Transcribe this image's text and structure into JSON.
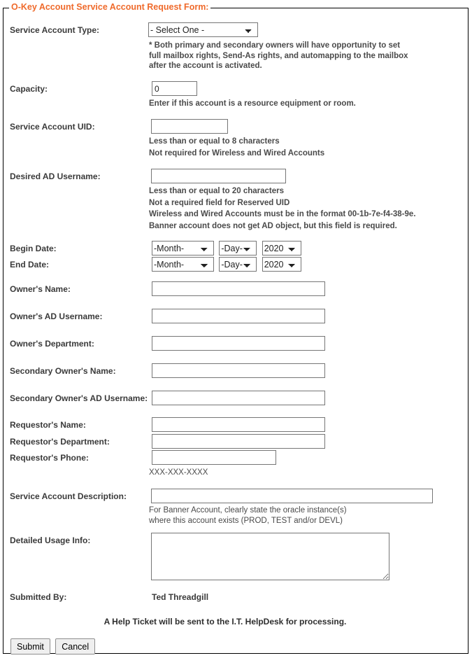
{
  "form": {
    "legend": "O-Key Account Service Account Request Form:",
    "fields": {
      "service_account_type": {
        "label": "Service Account Type:",
        "selected": "- Select One -",
        "options": [
          "- Select One -"
        ],
        "hints": [
          "* Both primary and secondary owners will have opportunity to set",
          "full mailbox rights, Send-As rights, and automapping to the mailbox",
          "after the account is activated."
        ]
      },
      "capacity": {
        "label": "Capacity:",
        "value": "0",
        "hints": [
          "Enter if this account is a resource equipment or room."
        ]
      },
      "service_account_uid": {
        "label": "Service Account UID:",
        "value": "",
        "hints": [
          "Less than or equal to 8 characters",
          "Not required for Wireless and Wired Accounts"
        ]
      },
      "desired_ad_username": {
        "label": "Desired AD Username:",
        "value": "",
        "hints": [
          "Less than or equal to 20 characters",
          "Not a required field for Reserved UID",
          "Wireless and Wired Accounts must be in the format 00-1b-7e-f4-38-9e.",
          "Banner account does not get AD object, but this field is required."
        ]
      },
      "begin_date": {
        "label": "Begin Date:",
        "month": "-Month-",
        "day": "-Day-",
        "year": "2020"
      },
      "end_date": {
        "label": "End Date:",
        "month": "-Month-",
        "day": "-Day-",
        "year": "2020"
      },
      "owner_name": {
        "label": "Owner's Name:",
        "value": ""
      },
      "owner_ad_username": {
        "label": "Owner's AD Username:",
        "value": ""
      },
      "owner_department": {
        "label": "Owner's Department:",
        "value": ""
      },
      "secondary_owner_name": {
        "label": "Secondary Owner's Name:",
        "value": ""
      },
      "secondary_owner_ad_username": {
        "label": "Secondary Owner's AD Username:",
        "value": ""
      },
      "requestor_name": {
        "label": "Requestor's Name:",
        "value": ""
      },
      "requestor_department": {
        "label": "Requestor's Department:",
        "value": ""
      },
      "requestor_phone": {
        "label": "Requestor's Phone:",
        "value": "",
        "hints": [
          "XXX-XXX-XXXX"
        ]
      },
      "service_account_description": {
        "label": "Service Account Description:",
        "value": "",
        "hints": [
          "For Banner Account, clearly state the oracle instance(s)",
          "where this account exists (PROD, TEST and/or DEVL)"
        ]
      },
      "detailed_usage_info": {
        "label": "Detailed Usage Info:",
        "value": ""
      },
      "submitted_by": {
        "label": "Submitted By:",
        "value": "Ted Threadgill"
      }
    },
    "notice": "A Help Ticket will be sent to the I.T. HelpDesk for processing.",
    "buttons": {
      "submit": "Submit",
      "cancel": "Cancel"
    },
    "colors": {
      "legend": "#ef6a2b",
      "border": "#000000",
      "field_border": "#767676"
    }
  }
}
